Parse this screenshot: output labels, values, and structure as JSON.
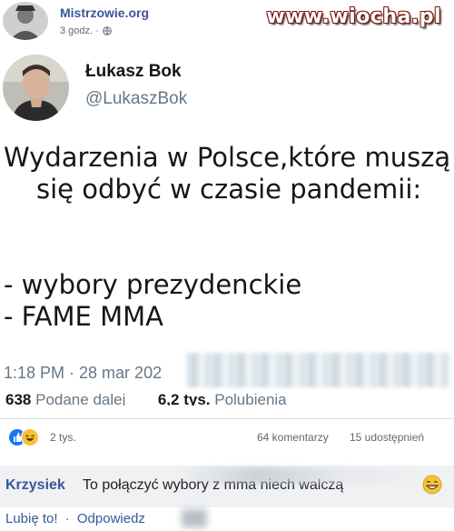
{
  "header": {
    "page_name": "Mistrzowie.org",
    "post_time": "3 godz. ·",
    "watermark": "www.wiocha.pl"
  },
  "tweet": {
    "author_name": "Łukasz Bok",
    "author_handle": "@LukaszBok",
    "text_lines": [
      "Wydarzenia w Polsce,które muszą",
      "się odbyć w czasie pandemii:",
      "- wybory prezydenckie",
      "- FAME MMA"
    ],
    "time": "1:18 PM · 28 mar 202",
    "retweets_count": "638",
    "retweets_label": "Podane dalej",
    "likes_count": "6,2 tys.",
    "likes_label": "Polubienia"
  },
  "reactions": {
    "count": "2 tys.",
    "comments": "64 komentarzy",
    "shares": "15 udostępnień",
    "like_color": "#1877f2",
    "haha_color": "#f7c23a"
  },
  "comment": {
    "author": "Krzysiek",
    "text": "To połączyć wybory z mma niech walczą",
    "like_action": "Lubię to!",
    "separator": "·",
    "reply_action": "Odpowiedz"
  },
  "icons": [
    "globe-icon",
    "like-reaction-icon",
    "haha-reaction-icon",
    "grin-emoji-icon"
  ]
}
